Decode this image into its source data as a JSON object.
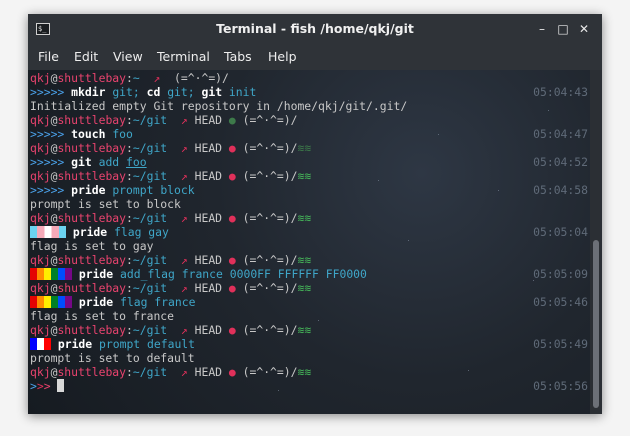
{
  "window": {
    "title": "Terminal - fish  /home/qkj/git",
    "icon": "terminal-icon"
  },
  "menu": [
    "File",
    "Edit",
    "View",
    "Terminal",
    "Tabs",
    "Help"
  ],
  "controls": {
    "minimize": "–",
    "maximize": "□",
    "close": "✕"
  },
  "prompt": {
    "user": "qkj",
    "at": "@",
    "host": "shuttlebay",
    "sep": ":",
    "path_home": "~",
    "path_git": "~/git",
    "branch": "HEAD",
    "dot": "●",
    "face": "(=^·^=)/",
    "chevrons": ">>>>>"
  },
  "lines": [
    {
      "time": ""
    },
    {
      "cmd": "mkdir",
      "args": "git; ",
      "cmd2": "cd",
      "args2": "git; ",
      "cmd3": "git",
      "args3": "init",
      "time": "05:04:43"
    },
    {
      "text": "Initialized empty Git repository in /home/qkj/git/.git/"
    },
    {
      "time": ""
    },
    {
      "cmd": "touch",
      "args": "foo",
      "time": "05:04:47"
    },
    {
      "time": ""
    },
    {
      "cmd": "git",
      "args": "add ",
      "ul": "foo",
      "time": "05:04:52"
    },
    {
      "time": ""
    },
    {
      "cmd": "pride",
      "args": "prompt block",
      "time": "05:04:58"
    },
    {
      "text": "prompt is set to block"
    },
    {
      "time": ""
    },
    {
      "cmd": "pride",
      "args": "flag gay",
      "time": "05:05:04"
    },
    {
      "text": "flag is set to gay"
    },
    {
      "time": ""
    },
    {
      "cmd": "pride",
      "args": "add_flag france 0000FF FFFFFF FF0000",
      "time": "05:05:09"
    },
    {
      "time": ""
    },
    {
      "cmd": "pride",
      "args": "flag france",
      "time": "05:05:46"
    },
    {
      "text": "flag is set to france"
    },
    {
      "time": ""
    },
    {
      "cmd": "pride",
      "args": "prompt default",
      "time": "05:05:49"
    },
    {
      "text": "prompt is set to default"
    },
    {
      "time": ""
    },
    {
      "time": "05:05:56"
    }
  ],
  "colors": {
    "user": "#e8436e",
    "path": "#3fa6c8",
    "green": "#46b85a",
    "timestamp": "#5f6a78",
    "background": "#20262e"
  },
  "flags": {
    "gay_stripes": [
      "#6bd3f0",
      "#f5a9b8",
      "#ffffff",
      "#f5a9b8",
      "#6bd3f0"
    ],
    "rainbow_stripes": [
      "#e40303",
      "#ff8c00",
      "#ffed00",
      "#008026",
      "#004dff",
      "#750787"
    ],
    "france_stripes": [
      "#0000ff",
      "#ffffff",
      "#ff0000"
    ]
  }
}
